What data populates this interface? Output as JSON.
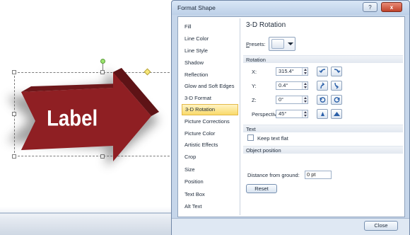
{
  "slide": {
    "shape_label": "Label",
    "colors": {
      "arrow_face": "#8f1f23",
      "arrow_side": "#5e1316",
      "arrow_top": "#6e171a",
      "label_text": "#ffffff"
    }
  },
  "dialog": {
    "title": "Format Shape",
    "window_buttons": {
      "help": "?",
      "close": "x"
    },
    "nav_items": [
      "Fill",
      "Line Color",
      "Line Style",
      "Shadow",
      "Reflection",
      "Glow and Soft Edges",
      "3-D Format",
      "3-D Rotation",
      "Picture Corrections",
      "Picture Color",
      "Artistic Effects",
      "Crop",
      "Size",
      "Position",
      "Text Box",
      "Alt Text"
    ],
    "active_nav": "3-D Rotation",
    "panel": {
      "title": "3-D Rotation",
      "presets_label": "Presets:",
      "rotation_section": "Rotation",
      "x_label": "X:",
      "x_value": "315.4°",
      "y_label": "Y:",
      "y_value": "0.4°",
      "z_label": "Z:",
      "z_value": "0°",
      "perspective_label": "Perspective:",
      "perspective_value": "45°",
      "text_section": "Text",
      "keep_text_flat_label": "Keep text flat",
      "keep_text_flat_checked": false,
      "object_position_section": "Object position",
      "distance_label": "Distance from ground:",
      "distance_value": "0 pt",
      "reset_label": "Reset"
    },
    "close_label": "Close",
    "rotation_buttons": [
      "rotate-left-icon",
      "rotate-right-icon",
      "rotate-up-icon",
      "rotate-down-icon",
      "rotate-counterclockwise-icon",
      "rotate-clockwise-icon",
      "perspective-narrow-icon",
      "perspective-widen-icon"
    ]
  }
}
